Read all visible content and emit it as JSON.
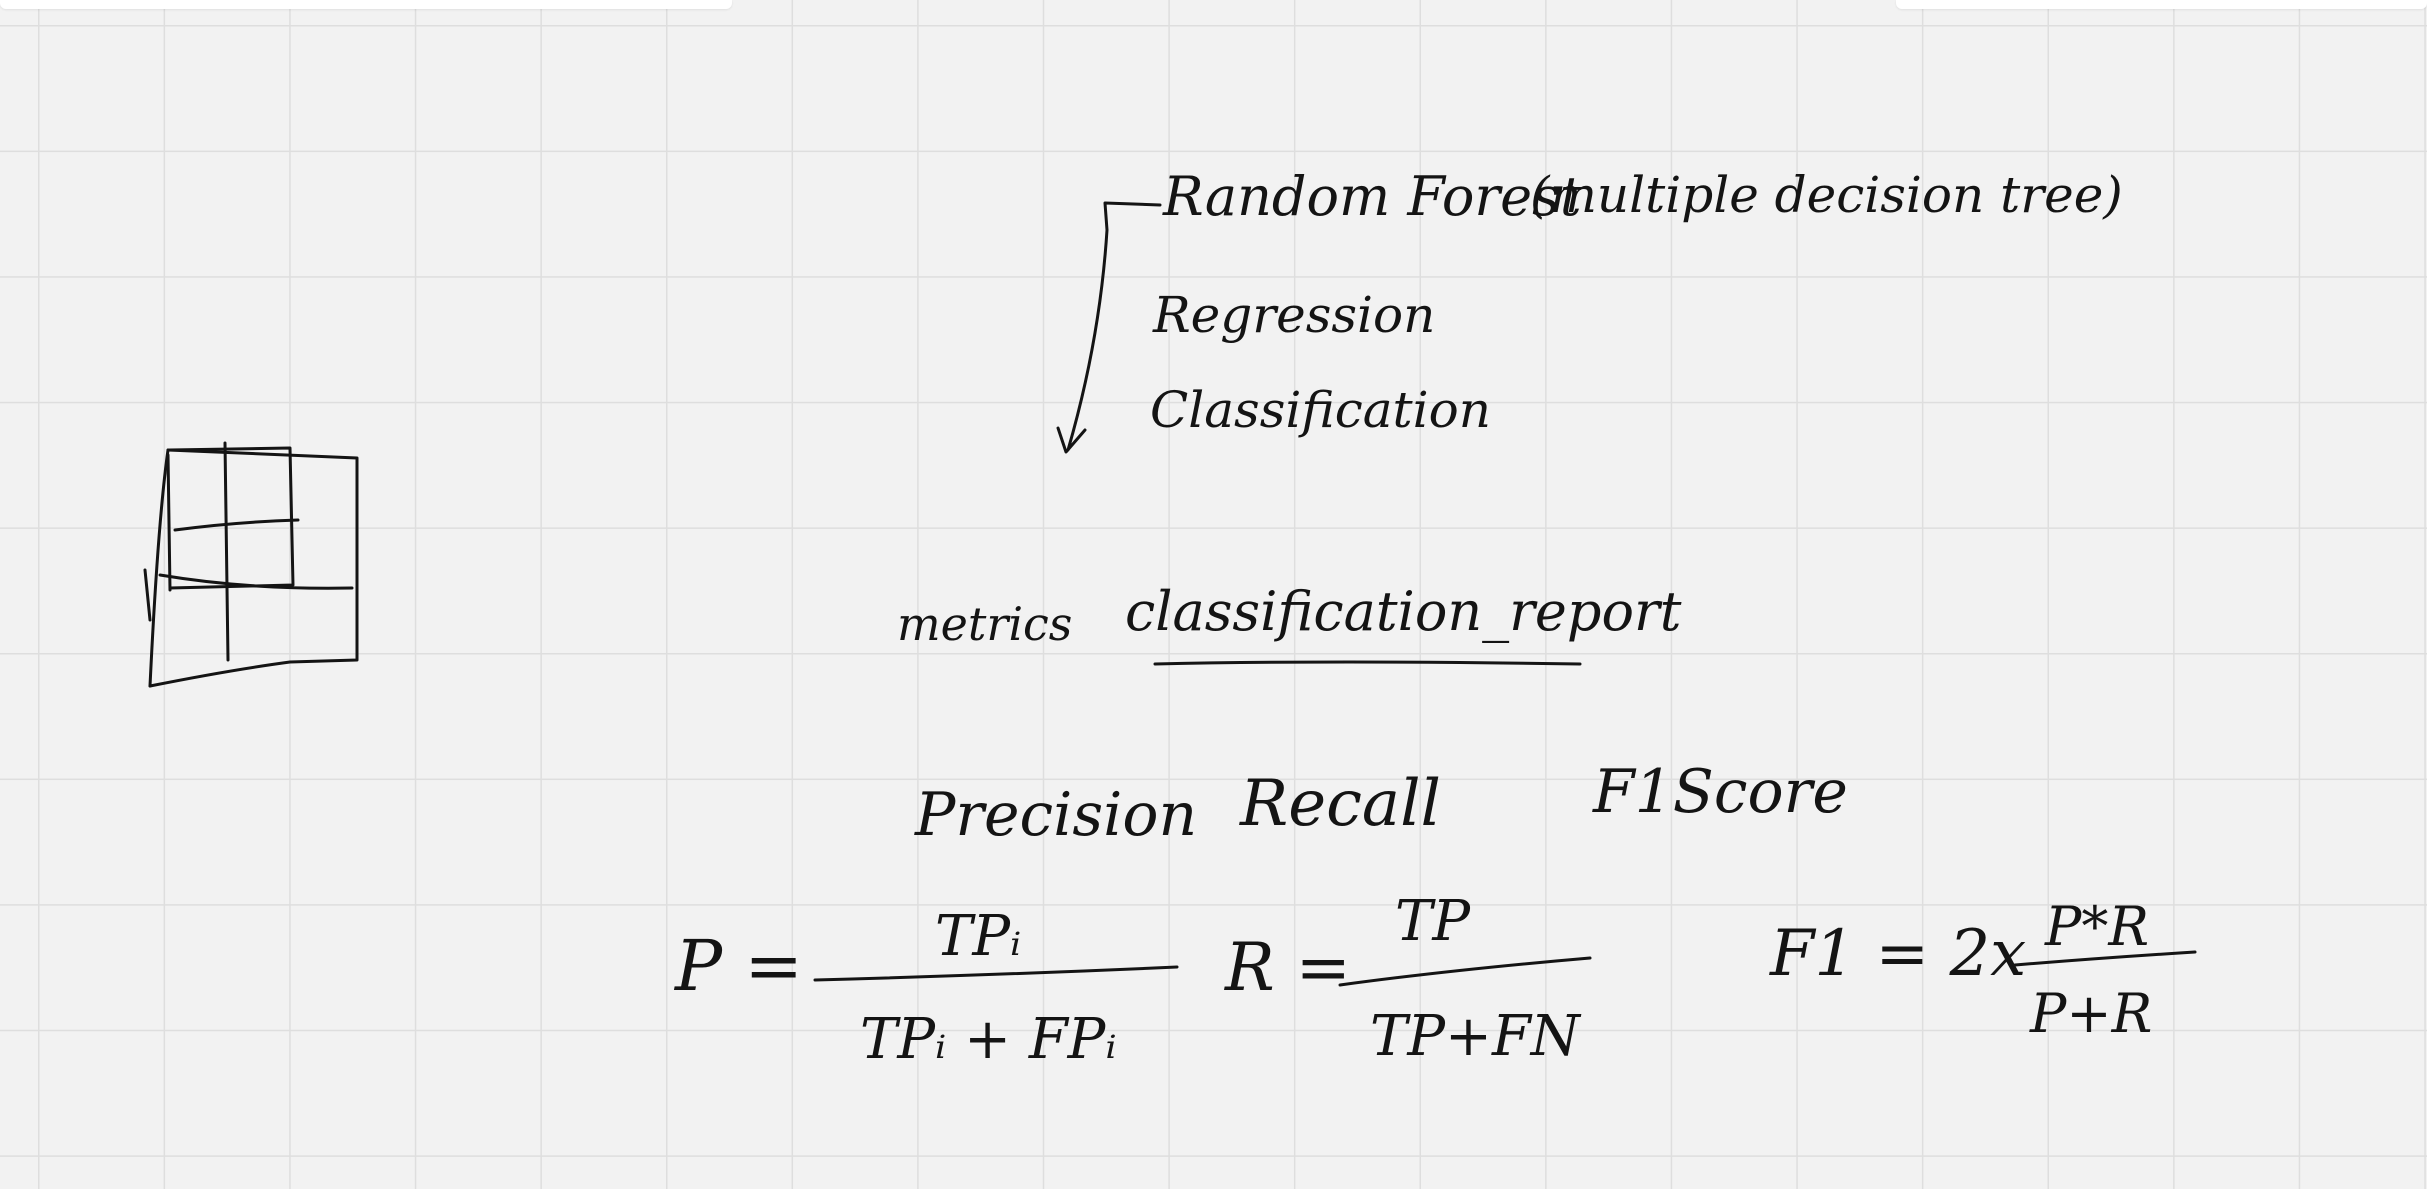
{
  "canvas": {
    "background": "#f2f2f2",
    "grid_color": "#dedede",
    "ink_color": "#141414"
  },
  "notes": {
    "random_forest": "Random Forest",
    "multiple_trees": "(multiple decision tree)",
    "regression": "Regression",
    "classification": "Classification",
    "metrics": "metrics",
    "classification_report": "classification_report",
    "precision": "Precision",
    "recall": "Recall",
    "f1score": "F1Score"
  },
  "formulas": {
    "p_label": "P =",
    "p_num": "TPᵢ",
    "p_den": "TPᵢ + FPᵢ",
    "r_label": "R =",
    "r_num": "TP",
    "r_den": "TP+FN",
    "f1_label": "F1 = 2x",
    "f1_num": "P*R",
    "f1_den": "P+R"
  }
}
